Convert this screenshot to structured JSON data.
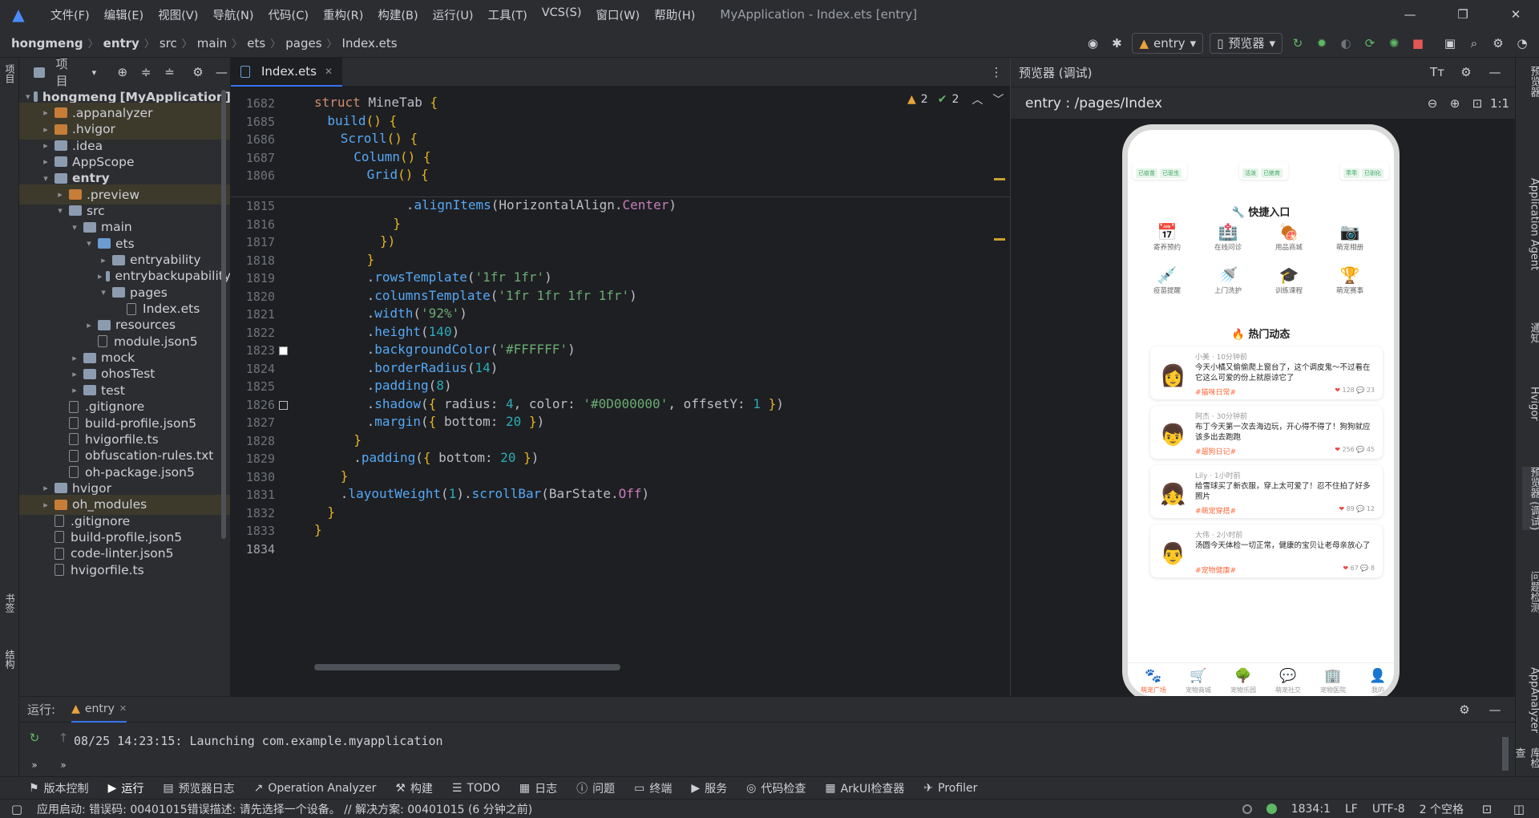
{
  "menu": [
    "文件(F)",
    "编辑(E)",
    "视图(V)",
    "导航(N)",
    "代码(C)",
    "重构(R)",
    "构建(B)",
    "运行(U)",
    "工具(T)",
    "VCS(S)",
    "窗口(W)",
    "帮助(H)"
  ],
  "window_title": "MyApplication - Index.ets [entry]",
  "breadcrumb": [
    "hongmeng",
    "entry",
    "src",
    "main",
    "ets",
    "pages",
    "Index.ets"
  ],
  "toolbar": {
    "module": "entry",
    "device": "预览器"
  },
  "project_panel": {
    "title": "项目"
  },
  "tree": [
    {
      "label": "hongmeng",
      "extra": "[MyApplication]",
      "indent": 0,
      "arrow": "▾",
      "kind": "folder",
      "bold": true
    },
    {
      "label": ".appanalyzer",
      "indent": 1,
      "arrow": "▸",
      "kind": "orange",
      "hl": true
    },
    {
      "label": ".hvigor",
      "indent": 1,
      "arrow": "▸",
      "kind": "orange",
      "hl": true
    },
    {
      "label": ".idea",
      "indent": 1,
      "arrow": "▸",
      "kind": "folder"
    },
    {
      "label": "AppScope",
      "indent": 1,
      "arrow": "▸",
      "kind": "folder"
    },
    {
      "label": "entry",
      "indent": 1,
      "arrow": "▾",
      "kind": "folder",
      "bold": true
    },
    {
      "label": ".preview",
      "indent": 2,
      "arrow": "▸",
      "kind": "orange",
      "hl": true
    },
    {
      "label": "src",
      "indent": 2,
      "arrow": "▾",
      "kind": "folder"
    },
    {
      "label": "main",
      "indent": 3,
      "arrow": "▾",
      "kind": "folder"
    },
    {
      "label": "ets",
      "indent": 4,
      "arrow": "▾",
      "kind": "blue"
    },
    {
      "label": "entryability",
      "indent": 5,
      "arrow": "▸",
      "kind": "folder"
    },
    {
      "label": "entrybackupability",
      "indent": 5,
      "arrow": "▸",
      "kind": "folder"
    },
    {
      "label": "pages",
      "indent": 5,
      "arrow": "▾",
      "kind": "folder"
    },
    {
      "label": "Index.ets",
      "indent": 6,
      "arrow": "",
      "kind": "file"
    },
    {
      "label": "resources",
      "indent": 4,
      "arrow": "▸",
      "kind": "folder"
    },
    {
      "label": "module.json5",
      "indent": 4,
      "arrow": "",
      "kind": "file"
    },
    {
      "label": "mock",
      "indent": 3,
      "arrow": "▸",
      "kind": "folder"
    },
    {
      "label": "ohosTest",
      "indent": 3,
      "arrow": "▸",
      "kind": "folder"
    },
    {
      "label": "test",
      "indent": 3,
      "arrow": "▸",
      "kind": "folder"
    },
    {
      "label": ".gitignore",
      "indent": 2,
      "arrow": "",
      "kind": "file"
    },
    {
      "label": "build-profile.json5",
      "indent": 2,
      "arrow": "",
      "kind": "file"
    },
    {
      "label": "hvigorfile.ts",
      "indent": 2,
      "arrow": "",
      "kind": "file"
    },
    {
      "label": "obfuscation-rules.txt",
      "indent": 2,
      "arrow": "",
      "kind": "file"
    },
    {
      "label": "oh-package.json5",
      "indent": 2,
      "arrow": "",
      "kind": "file"
    },
    {
      "label": "hvigor",
      "indent": 1,
      "arrow": "▸",
      "kind": "folder"
    },
    {
      "label": "oh_modules",
      "indent": 1,
      "arrow": "▸",
      "kind": "orange",
      "hl": true
    },
    {
      "label": ".gitignore",
      "indent": 1,
      "arrow": "",
      "kind": "file"
    },
    {
      "label": "build-profile.json5",
      "indent": 1,
      "arrow": "",
      "kind": "file"
    },
    {
      "label": "code-linter.json5",
      "indent": 1,
      "arrow": "",
      "kind": "file"
    },
    {
      "label": "hvigorfile.ts",
      "indent": 1,
      "arrow": "",
      "kind": "file"
    }
  ],
  "editor_tab": "Index.ets",
  "inspection": {
    "warnings": "2",
    "ok": "2"
  },
  "sticky_lines": [
    {
      "n": "1682",
      "html": "<span class='kw'>struct</span> <span class='cls' style='color:#bcbec4'>MineTab</span> <span class='par'>{</span>",
      "indent": 0
    },
    {
      "n": "1685",
      "html": "<span class='fn'>build</span><span class='par'>()</span> <span class='par'>{</span>",
      "indent": 2
    },
    {
      "n": "1686",
      "html": "<span class='fn'>Scroll</span><span class='par'>()</span> <span class='par'>{</span>",
      "indent": 4
    },
    {
      "n": "1687",
      "html": "<span class='fn'>Column</span><span class='par'>()</span> <span class='par'>{</span>",
      "indent": 6
    },
    {
      "n": "1806",
      "html": "<span class='fn'>Grid</span><span class='par'>()</span> <span class='par'>{</span>",
      "indent": 8
    }
  ],
  "code_lines": [
    {
      "n": "1815",
      "html": ".<span class='fn'>alignItems</span>(HorizontalAlign.<span class='enm'>Center</span>)",
      "indent": 14
    },
    {
      "n": "1816",
      "html": "<span class='par'>}</span>",
      "indent": 12
    },
    {
      "n": "1817",
      "html": "<span class='par'>})</span>",
      "indent": 10
    },
    {
      "n": "1818",
      "html": "<span class='par'>}</span>",
      "indent": 8
    },
    {
      "n": "1819",
      "html": ".<span class='fn'>rowsTemplate</span>(<span class='str'>'1fr 1fr'</span>)",
      "indent": 8
    },
    {
      "n": "1820",
      "html": ".<span class='fn'>columnsTemplate</span>(<span class='str'>'1fr 1fr 1fr 1fr'</span>)",
      "indent": 8
    },
    {
      "n": "1821",
      "html": ".<span class='fn'>width</span>(<span class='str'>'92%'</span>)",
      "indent": 8
    },
    {
      "n": "1822",
      "html": ".<span class='fn'>height</span>(<span class='num'>140</span>)",
      "indent": 8
    },
    {
      "n": "1823",
      "html": ".<span class='fn'>backgroundColor</span>(<span class='str'>'#FFFFFF'</span>)",
      "indent": 8
    },
    {
      "n": "1824",
      "html": ".<span class='fn'>borderRadius</span>(<span class='num'>14</span>)",
      "indent": 8
    },
    {
      "n": "1825",
      "html": ".<span class='fn'>padding</span>(<span class='num'>8</span>)",
      "indent": 8
    },
    {
      "n": "1826",
      "html": ".<span class='fn'>shadow</span>(<span class='par'>{</span> radius: <span class='num'>4</span>, color: <span class='str'>'#0D000000'</span>, offsetY: <span class='num'>1</span> <span class='par'>}</span>)",
      "indent": 8
    },
    {
      "n": "1827",
      "html": ".<span class='fn'>margin</span>(<span class='par'>{</span> bottom: <span class='num'>20</span> <span class='par'>}</span>)",
      "indent": 8
    },
    {
      "n": "1828",
      "html": "<span class='par'>}</span>",
      "indent": 6
    },
    {
      "n": "1829",
      "html": ".<span class='fn'>padding</span>(<span class='par'>{</span> bottom: <span class='num'>20</span> <span class='par'>}</span>)",
      "indent": 6
    },
    {
      "n": "1830",
      "html": "<span class='par'>}</span>",
      "indent": 4
    },
    {
      "n": "1831",
      "html": ".<span class='fn'>layoutWeight</span>(<span class='num'>1</span>).<span class='fn'>scrollBar</span>(BarState.<span class='enm'>Off</span>)",
      "indent": 4
    },
    {
      "n": "1832",
      "html": "<span class='par'>}</span>",
      "indent": 2
    },
    {
      "n": "1833",
      "html": "<span class='par'>}</span>",
      "indent": 0
    },
    {
      "n": "1834",
      "html": "",
      "indent": 0
    }
  ],
  "preview_panel": {
    "title": "预览器 (调试)",
    "route": "entry : /pages/Index"
  },
  "phone": {
    "top_tags": [
      "已疫苗",
      "已驱虫",
      "活泼",
      "已绝育",
      "乖乖",
      "已驯化"
    ],
    "quick_title": "快捷入口",
    "quick_items": [
      {
        "icon": "📅",
        "label": "寄养预约"
      },
      {
        "icon": "🏥",
        "label": "在线问诊"
      },
      {
        "icon": "🍖",
        "label": "用品商城"
      },
      {
        "icon": "📷",
        "label": "萌宠相册"
      },
      {
        "icon": "💉",
        "label": "疫苗提醒"
      },
      {
        "icon": "🚿",
        "label": "上门洗护"
      },
      {
        "icon": "🎓",
        "label": "训练课程"
      },
      {
        "icon": "🏆",
        "label": "萌宠赛事"
      }
    ],
    "hot_title": "热门动态",
    "feeds": [
      {
        "avatar": "👩",
        "meta": "小美 · 10分钟前",
        "text": "今天小橘又偷偷爬上窗台了，这个调皮鬼～不过看在它这么可爱的份上就原谅它了",
        "tag": "#猫咪日常#",
        "likes": "128",
        "comments": "23"
      },
      {
        "avatar": "👦",
        "meta": "阿杰 · 30分钟前",
        "text": "布丁今天第一次去海边玩，开心得不得了！狗狗就应该多出去跑跑",
        "tag": "#遛狗日记#",
        "likes": "256",
        "comments": "45"
      },
      {
        "avatar": "👧",
        "meta": "Lily · 1小时前",
        "text": "给雪球买了新衣服，穿上太可爱了！忍不住拍了好多照片",
        "tag": "#萌宠穿搭#",
        "likes": "89",
        "comments": "12"
      },
      {
        "avatar": "👨",
        "meta": "大伟 · 2小时前",
        "text": "汤圆今天体检一切正常，健康的宝贝让老母亲放心了",
        "tag": "#宠物健康#",
        "likes": "67",
        "comments": "8"
      }
    ],
    "bottom_nav": [
      {
        "icon": "🐾",
        "label": "萌宠广场",
        "active": true
      },
      {
        "icon": "🛒",
        "label": "宠物商城",
        "active": false
      },
      {
        "icon": "🌳",
        "label": "宠物乐园",
        "active": false
      },
      {
        "icon": "💬",
        "label": "萌宠社交",
        "active": false
      },
      {
        "icon": "🏢",
        "label": "宠物医院",
        "active": false
      },
      {
        "icon": "👤",
        "label": "我的",
        "active": false
      }
    ]
  },
  "right_strip": [
    "预览器",
    "Application Agent",
    "通知",
    "Hvigor",
    "预览器 (调试)",
    "问题检测",
    "AppAnalyzer",
    "数据库检查"
  ],
  "left_strip": [
    "项目",
    "书签",
    "结构"
  ],
  "run_panel": {
    "title": "运行:",
    "tab": "entry",
    "log": "08/25 14:23:15: Launching com.example.myapplication"
  },
  "tool_windows": [
    {
      "icon": "⚑",
      "label": "版本控制"
    },
    {
      "icon": "▶",
      "label": "运行"
    },
    {
      "icon": "▤",
      "label": "预览器日志"
    },
    {
      "icon": "↗",
      "label": "Operation Analyzer"
    },
    {
      "icon": "⚒",
      "label": "构建"
    },
    {
      "icon": "☰",
      "label": "TODO"
    },
    {
      "icon": "▦",
      "label": "日志"
    },
    {
      "icon": "ⓘ",
      "label": "问题"
    },
    {
      "icon": "▭",
      "label": "终端"
    },
    {
      "icon": "▶",
      "label": "服务"
    },
    {
      "icon": "◎",
      "label": "代码检查"
    },
    {
      "icon": "▦",
      "label": "ArkUI检查器"
    },
    {
      "icon": "✈",
      "label": "Profiler"
    }
  ],
  "status": {
    "message": "应用启动: 错误码: 00401015错误描述: 请先选择一个设备。 // 解决方案: 00401015 (6 分钟之前)",
    "position": "1834:1",
    "line_sep": "LF",
    "encoding": "UTF-8",
    "indent": "2 个空格"
  }
}
